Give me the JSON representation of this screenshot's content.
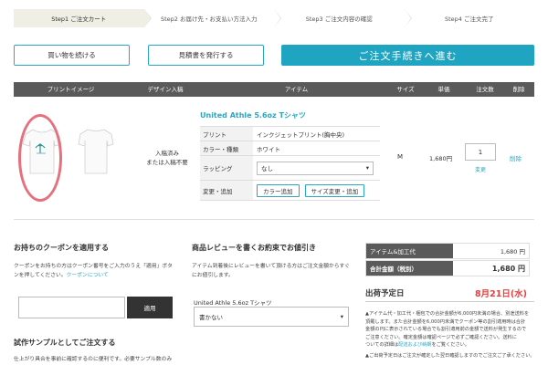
{
  "steps": [
    {
      "label": "Step1 ご注文カート"
    },
    {
      "label": "Step2 お届け先・お支払い方法入力"
    },
    {
      "label": "Step3 ご注文内容の確認"
    },
    {
      "label": "Step4 ご注文完了"
    }
  ],
  "actions": {
    "continue_shopping": "買い物を続ける",
    "estimate": "見積書を発行する",
    "checkout": "ご注文手続きへ進む"
  },
  "table_header": {
    "print_image": "プリントイメージ",
    "design": "デザイン入稿",
    "item": "アイテム",
    "size": "サイズ",
    "unit_price": "単価",
    "qty": "注文数",
    "delete": "削除"
  },
  "product": {
    "design_status_line1": "入稿済み",
    "design_status_line2": "または入稿不要",
    "title": "United Athle 5.6oz Tシャツ",
    "spec": {
      "print_key": "プリント",
      "print_val": "インクジェットプリント(胸中央)",
      "color_key": "カラー・種類",
      "color_val": "ホワイト",
      "wrap_key": "ラッピング",
      "wrap_val": "なし",
      "change_key": "変更・追加",
      "add_color": "カラー追加",
      "size_change": "サイズ変更・追加"
    },
    "size": "M",
    "price": "1,680円",
    "qty": "1",
    "change_link": "変更",
    "delete_link": "削除"
  },
  "coupon": {
    "title": "お持ちのクーポンを適用する",
    "desc1": "クーポンをお持ちの方はクーポン番号をご入力のうえ「適用」ボタ",
    "desc2": "ンを押してください。",
    "link": "クーポンについて",
    "apply": "適用"
  },
  "sample": {
    "title": "試作サンプルとしてご注文する",
    "desc": "仕上がり具合を事前に確認するのに便利です。必要サンプル数のみ"
  },
  "review": {
    "title": "商品レビューを書くお約束でお値引き",
    "desc1": "アイテム到着後にレビューを書いて頂ける方はご注文金額からすぐ",
    "desc2": "にお値引します。",
    "item_label": "United Athle 5.6oz Tシャツ",
    "select": "書かない"
  },
  "totals": {
    "item_fee_label": "アイテム&加工代",
    "item_fee": "1,680 円",
    "total_label": "合計金額（税別）",
    "total": "1,680 円",
    "ship_label": "出荷予定日",
    "ship_date": "8月21日(水)"
  },
  "notes": {
    "n1": "アイテム代・加工代・梱包での合計金額が6,000円未満の場合、別途送料を",
    "n2": "頂戴します。また合計金額を6,000円未満でクーポン等の割引適用時は合計",
    "n3": "金額の円に表示されている場合でも割引適用前の金額で送料が発生するので",
    "n4": "ご注意ください。確定金額は確認ページで必ずご確認ください。送料に",
    "n5": "ついての詳細は",
    "n5link": "配送および納期",
    "n5b": "をご覧ください。",
    "n6": "ご出荷予定日はご注文が確定した翌日確認しますのでご注文ご了承ください。"
  }
}
